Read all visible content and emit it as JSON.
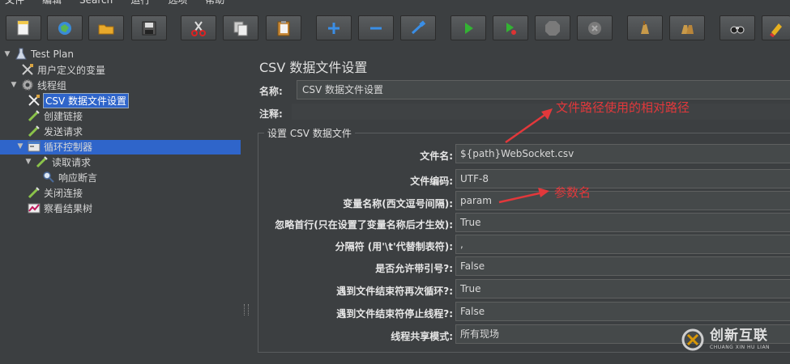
{
  "menubar": {
    "items": [
      "文件",
      "编辑",
      "Search",
      "运行",
      "选项",
      "帮助"
    ]
  },
  "toolbar": {
    "buttons": [
      "new-icon",
      "templates-icon",
      "open-icon",
      "save-icon",
      "cut-icon",
      "copy-icon",
      "paste-icon",
      "expand-icon",
      "collapse-icon",
      "toggle-icon",
      "start-icon",
      "start-no-pause-icon",
      "stop-icon",
      "shutdown-icon",
      "clear-icon",
      "clear-all-icon",
      "search-icon",
      "reset-search-icon"
    ]
  },
  "tree": {
    "nodes": [
      {
        "label": "Test Plan",
        "icon": "test-plan-icon"
      },
      {
        "label": "用户定义的变量",
        "icon": "config-icon"
      },
      {
        "label": "线程组",
        "icon": "thread-group-icon"
      },
      {
        "label": "CSV 数据文件设置",
        "icon": "config-icon"
      },
      {
        "label": "创建链接",
        "icon": "sampler-icon"
      },
      {
        "label": "发送请求",
        "icon": "sampler-icon"
      },
      {
        "label": "循环控制器",
        "icon": "controller-icon"
      },
      {
        "label": "读取请求",
        "icon": "sampler-icon"
      },
      {
        "label": "响应断言",
        "icon": "assertion-icon"
      },
      {
        "label": "关闭连接",
        "icon": "sampler-icon"
      },
      {
        "label": "察看结果树",
        "icon": "listener-icon"
      }
    ]
  },
  "panel": {
    "title": "CSV 数据文件设置",
    "name_label": "名称:",
    "name_value": "CSV 数据文件设置",
    "comment_label": "注释:",
    "comment_value": "",
    "group_title": "设置 CSV 数据文件",
    "fields": [
      {
        "label": "文件名:",
        "value": "${path}WebSocket.csv"
      },
      {
        "label": "文件编码:",
        "value": "UTF-8"
      },
      {
        "label": "变量名称(西文逗号间隔):",
        "value": "param"
      },
      {
        "label": "忽略首行(只在设置了变量名称后才生效):",
        "value": "True"
      },
      {
        "label": "分隔符 (用'\\t'代替制表符):",
        "value": ","
      },
      {
        "label": "是否允许带引号?:",
        "value": "False"
      },
      {
        "label": "遇到文件结束符再次循环?:",
        "value": "True"
      },
      {
        "label": "遇到文件结束符停止线程?:",
        "value": "False"
      },
      {
        "label": "线程共享模式:",
        "value": "所有现场"
      }
    ]
  },
  "annotations": {
    "path_note": "文件路径使用的相对路径",
    "param_note": "参数名",
    "color": "#e2383b"
  },
  "watermark": {
    "main": "创新互联",
    "sub": "CHUANG XIN HU LIAN"
  },
  "colors": {
    "background": "#3c3f41",
    "selection": "#2f65ca",
    "field_bg": "#45494a"
  }
}
